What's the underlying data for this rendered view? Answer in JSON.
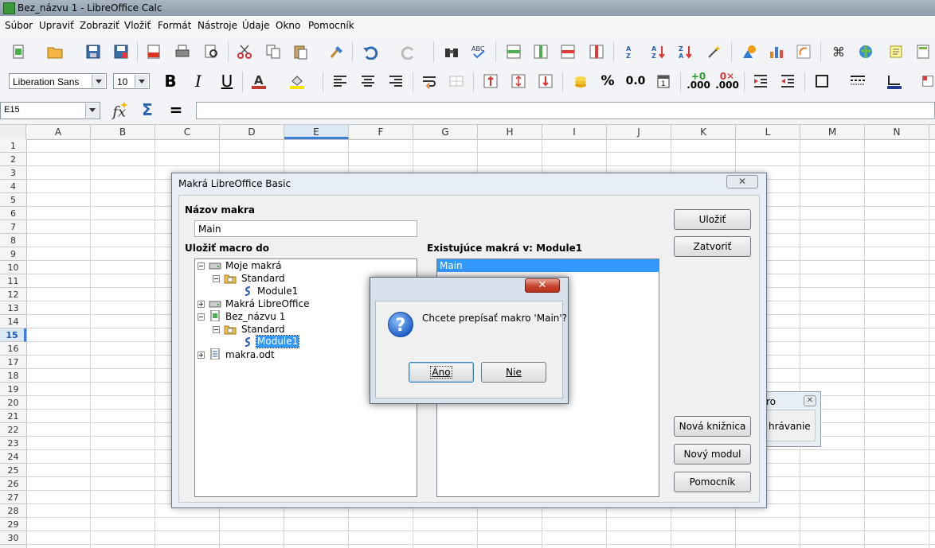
{
  "window": {
    "title": "Bez_názvu 1 - LibreOffice Calc"
  },
  "menu": {
    "items": [
      {
        "label": "Súbor"
      },
      {
        "label": "Upraviť"
      },
      {
        "label": "Zobraziť"
      },
      {
        "label": "Vložiť"
      },
      {
        "label": "Formát"
      },
      {
        "label": "Nástroje"
      },
      {
        "label": "Údaje"
      },
      {
        "label": "Okno"
      },
      {
        "label": "Pomocník"
      }
    ]
  },
  "format_toolbar": {
    "font_name": "Liberation Sans",
    "font_size": "10",
    "percent_label": "%",
    "decimal_label": "0.0",
    "add_decimal_label": ".000",
    "del_decimal_label": ".000"
  },
  "formula_bar": {
    "name_box": "E15",
    "equals": "="
  },
  "sheet": {
    "columns": [
      "A",
      "B",
      "C",
      "D",
      "E",
      "F",
      "G",
      "H",
      "I",
      "J",
      "K",
      "L",
      "M",
      "N"
    ],
    "active_column": "E",
    "rows": [
      "1",
      "2",
      "3",
      "4",
      "5",
      "6",
      "7",
      "8",
      "9",
      "10",
      "11",
      "12",
      "13",
      "14",
      "15",
      "16",
      "17",
      "18",
      "19",
      "20",
      "21",
      "22",
      "23",
      "24",
      "25",
      "26",
      "27",
      "28",
      "29",
      "30"
    ],
    "active_row": "15"
  },
  "macro_dialog": {
    "title": "Makrá LibreOffice Basic",
    "close_glyph": "✕",
    "macro_name_label": "Názov makra",
    "macro_name_value": "Main",
    "save_in_label": "Uložiť macro do",
    "existing_label": "Existujúce makrá v: Module1",
    "existing_items": [
      "Main"
    ],
    "tree": {
      "my_macros": "Moje makrá",
      "standard1": "Standard",
      "module1a": "Module1",
      "lo_macros": "Makrá LibreOffice",
      "document": "Bez_názvu 1",
      "standard2": "Standard",
      "module1b": "Module1",
      "file": "makra.odt"
    },
    "buttons": {
      "save": "Uložiť",
      "close": "Zatvoriť",
      "new_library": "Nová knižnica",
      "new_module": "Nový modul",
      "help": "Pomocník"
    }
  },
  "bg_dialog": {
    "title_fragment": "ro",
    "text_fragment": "hrávanie",
    "close_glyph": "✕"
  },
  "confirm_dialog": {
    "message": "Chcete prepísať makro 'Main'?",
    "yes": "Áno",
    "no": "Nie",
    "close_glyph": "✕"
  },
  "colors": {
    "selection": "#3399ff",
    "dialog_frame": "#e8eef5",
    "accent_blue": "#3b7fd6",
    "close_red": "#c6452f"
  }
}
